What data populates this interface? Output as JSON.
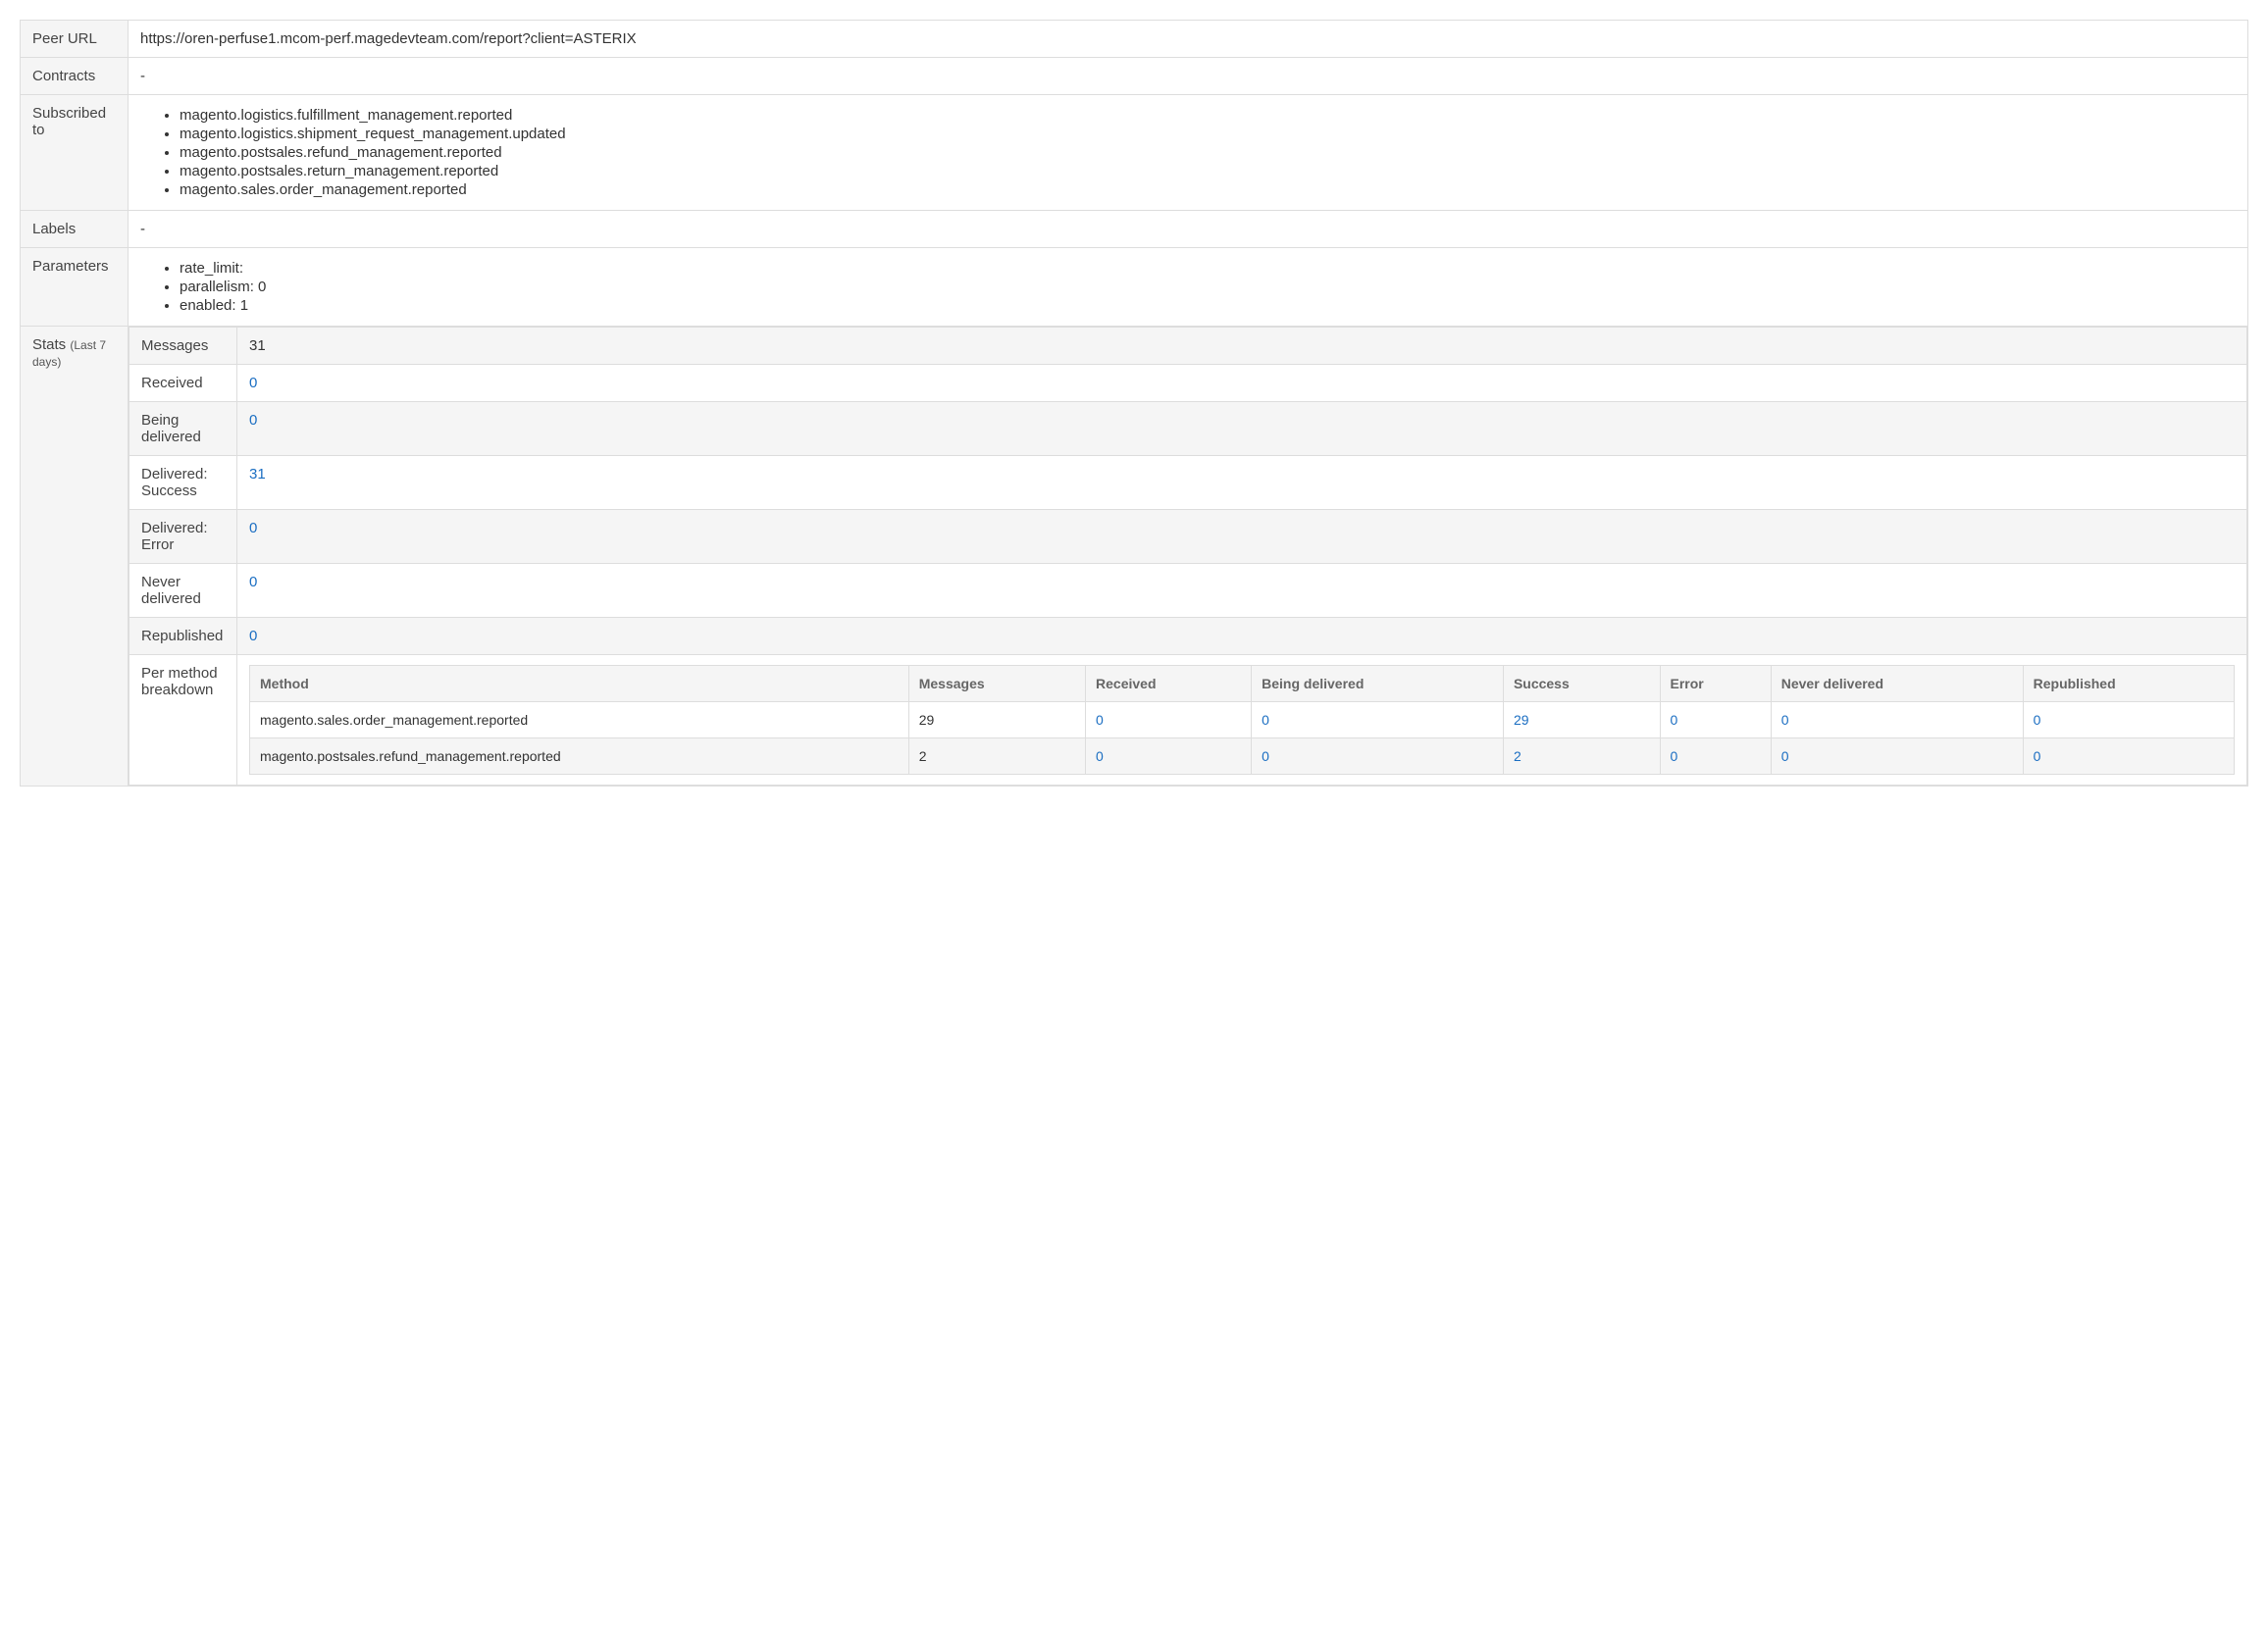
{
  "fields": {
    "peer_url": {
      "label": "Peer URL",
      "value": "https://oren-perfuse1.mcom-perf.magedevteam.com/report?client=ASTERIX"
    },
    "contracts": {
      "label": "Contracts",
      "value": "-"
    },
    "subscribed_to": {
      "label": "Subscribed to",
      "items": [
        "magento.logistics.fulfillment_management.reported",
        "magento.logistics.shipment_request_management.updated",
        "magento.postsales.refund_management.reported",
        "magento.postsales.return_management.reported",
        "magento.sales.order_management.reported"
      ]
    },
    "labels": {
      "label": "Labels",
      "value": "-"
    },
    "parameters": {
      "label": "Parameters",
      "items": [
        "rate_limit:",
        "parallelism: 0",
        "enabled: 1"
      ]
    }
  },
  "stats": {
    "label": "Stats",
    "note": "(Last 7 days)",
    "rows": {
      "messages": {
        "label": "Messages",
        "value": "31",
        "link": false
      },
      "received": {
        "label": "Received",
        "value": "0",
        "link": true
      },
      "being_delivered": {
        "label": "Being delivered",
        "value": "0",
        "link": true
      },
      "delivered_success": {
        "label": "Delivered: Success",
        "value": "31",
        "link": true
      },
      "delivered_error": {
        "label": "Delivered: Error",
        "value": "0",
        "link": true
      },
      "never_delivered": {
        "label": "Never delivered",
        "value": "0",
        "link": true
      },
      "republished": {
        "label": "Republished",
        "value": "0",
        "link": true
      }
    },
    "breakdown": {
      "label": "Per method breakdown",
      "headers": {
        "method": "Method",
        "messages": "Messages",
        "received": "Received",
        "being_delivered": "Being delivered",
        "success": "Success",
        "error": "Error",
        "never_delivered": "Never delivered",
        "republished": "Republished"
      },
      "rows": [
        {
          "method": "magento.sales.order_management.reported",
          "messages": "29",
          "received": "0",
          "being_delivered": "0",
          "success": "29",
          "error": "0",
          "never_delivered": "0",
          "republished": "0"
        },
        {
          "method": "magento.postsales.refund_management.reported",
          "messages": "2",
          "received": "0",
          "being_delivered": "0",
          "success": "2",
          "error": "0",
          "never_delivered": "0",
          "republished": "0"
        }
      ]
    }
  }
}
